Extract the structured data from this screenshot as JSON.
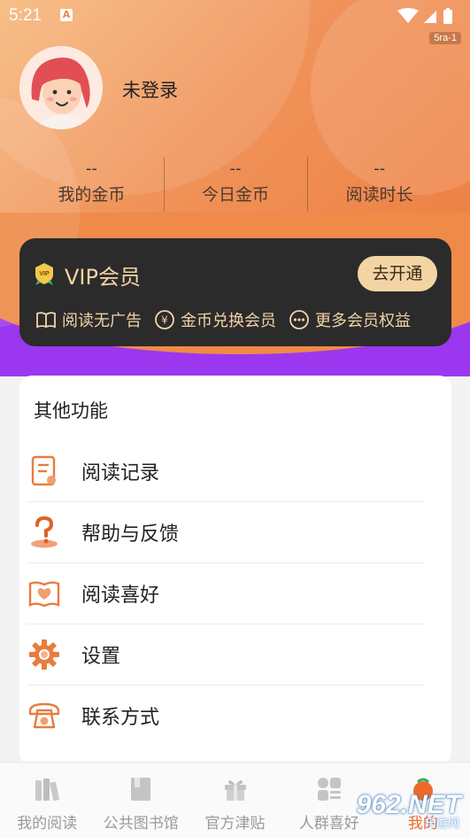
{
  "status": {
    "time": "5:21",
    "a_label": "A",
    "network_badge": "5ra-1"
  },
  "profile": {
    "username": "未登录"
  },
  "stats": [
    {
      "value": "--",
      "label": "我的金币"
    },
    {
      "value": "--",
      "label": "今日金币"
    },
    {
      "value": "--",
      "label": "阅读时长"
    }
  ],
  "vip": {
    "icon_text": "VIP",
    "title": "VIP会员",
    "open_button": "去开通",
    "perks": [
      {
        "icon": "book-open-icon",
        "label": "阅读无广告"
      },
      {
        "icon": "yen-coin-icon",
        "label": "金币兑换会员"
      },
      {
        "icon": "more-dots-icon",
        "label": "更多会员权益"
      }
    ]
  },
  "other": {
    "title": "其他功能",
    "items": [
      {
        "icon": "reading-record-icon",
        "label": "阅读记录"
      },
      {
        "icon": "help-question-icon",
        "label": "帮助与反馈"
      },
      {
        "icon": "heart-book-icon",
        "label": "阅读喜好"
      },
      {
        "icon": "gear-icon",
        "label": "设置"
      },
      {
        "icon": "telephone-icon",
        "label": "联系方式"
      }
    ]
  },
  "nav": {
    "tabs": [
      {
        "icon": "bookshelf-icon",
        "label": "我的阅读"
      },
      {
        "icon": "library-book-icon",
        "label": "公共图书馆"
      },
      {
        "icon": "gift-icon",
        "label": "官方津贴"
      },
      {
        "icon": "grid-list-icon",
        "label": "人群喜好"
      },
      {
        "icon": "profile-tab-icon",
        "label": "我的"
      }
    ]
  },
  "watermark": {
    "text": "962.NET",
    "subtext": "乐游网"
  },
  "colors": {
    "accent": "#ec7a3c",
    "purple": "#9b37ee",
    "vip_gold": "#f4d3a4",
    "vip_bg": "#2b2b2b"
  }
}
